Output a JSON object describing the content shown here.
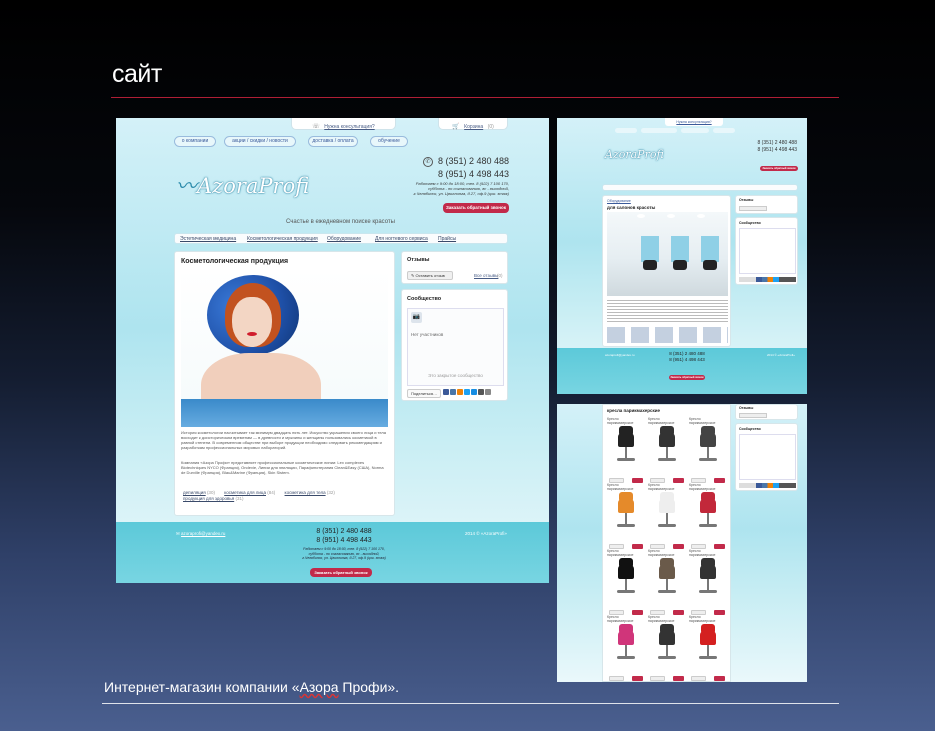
{
  "slide": {
    "title": "сайт",
    "caption_before": "Интернет-магазин компании «",
    "caption_underlined": "Азора",
    "caption_after": " Профи»."
  },
  "colors": {
    "accent": "#c22a4a",
    "footer_teal": "#5cc9d9",
    "link": "#3a5a9a",
    "rule": "#b01e35"
  },
  "site": {
    "logo": "AzoraProfi",
    "consult": "Нужна консультация?",
    "cart": "Корзина",
    "cart_count": "(0)",
    "nav_pills": [
      "о компании",
      "акции / скидки / новости",
      "доставка / оплата",
      "обучение"
    ],
    "phone1": "8 (351) 2 480 488",
    "phone2": "8 (951) 4 498 443",
    "hours_lines": [
      "Работаем с 9:00 до 18:00, тел. 8 (922) 7 100 170,",
      "суббота - по согласованию, вс - выходной,",
      "г.Челябинск, ул. Цвиллинга, д.27, оф.9 (цок. этаж)"
    ],
    "callback": "Заказать обратный звонок",
    "slogan": "Счастье в ежедневном поиске красоты",
    "menu": [
      "Эстетическая медицина",
      "Косметологическая продукция",
      "Оборудование",
      "Для ногтевого сервиса",
      "Прайсы"
    ],
    "content_title": "Косметологическая продукция",
    "para1": "История косметологии насчитывает так минимум двадцать пять лет. Искусство украшения своего лица и тела восходит к доисторическим временам — в древности и мужчины и женщины пользовались косметикой в равной степени. В современном обществе при выборе продукции необходимо следовать рекомендациям и разработкам профессиональных мировых лабораторий.",
    "para2": "Компания «Азора Профи» представляет профессиональные косметические линии: Lex complexes Biotechniques NYCO (Франция), Ondevie, Линии для эпиляции, Парафинотерапия Clean&Easy (США), Norma de Durville (Франция), Blau&Marine (Франция), Skin Sistem.",
    "links": [
      {
        "label": "депиляция",
        "count": "(30)"
      },
      {
        "label": "косметика для лица",
        "count": "(84)"
      },
      {
        "label": "косметика для тела",
        "count": "(32)"
      },
      {
        "label": "продукция для здоровья",
        "count": "(31)"
      }
    ],
    "reviews_title": "Отзывы",
    "leave_review": "Оставить отзыв",
    "all_reviews": "Все отзывы",
    "all_reviews_count": "(0)",
    "community_title": "Сообщество",
    "no_members": "Нет участников",
    "closed_community": "Это закрытое сообщество",
    "share": "Поделиться…",
    "email": "azoraprofi@yandex.ru",
    "copyright": "2014 © «AzoraProfi»"
  },
  "shot2": {
    "breadcrumb": "Оборудование",
    "title": "для салонов красоты",
    "consult": "Нужна консультация?",
    "menu": [
      "Эстетическая медицина",
      "Косметологическая продукция",
      "Оборудование",
      "Для ногтевого сервиса",
      "Прайсы"
    ]
  },
  "shot3": {
    "title": "кресла парикмахерские",
    "consult": "Нужна консультация?",
    "product_label": "Кресло парикмахерское",
    "chairs": [
      "#222",
      "#333",
      "#444",
      "#e58a2a",
      "#eee",
      "#c2283a",
      "#111",
      "#6a5a4a",
      "#333",
      "#d0357a",
      "#333",
      "#d42020"
    ]
  }
}
